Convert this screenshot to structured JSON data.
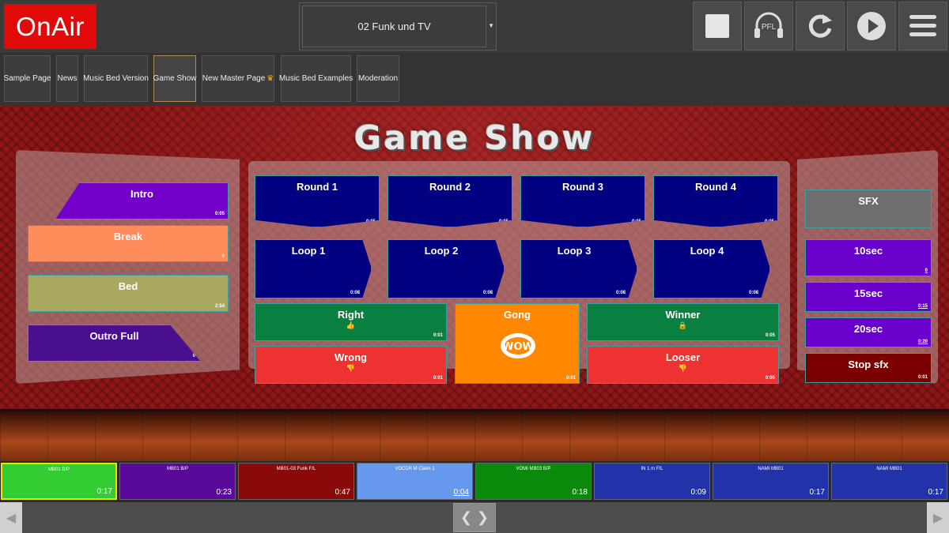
{
  "header": {
    "logo": "OnAir",
    "playlist": "02 Funk und TV",
    "buttons": {
      "stop": "stop-icon",
      "pfl": "PFL",
      "reload": "reload-icon",
      "play": "play-icon",
      "menu": "menu-icon"
    }
  },
  "tabs": [
    {
      "label": "Sample Page"
    },
    {
      "label": "News"
    },
    {
      "label": "Music Bed Version"
    },
    {
      "label": "Game Show",
      "active": true
    },
    {
      "label": "New Master Page"
    },
    {
      "label": "Music Bed Examples"
    },
    {
      "label": "Moderation"
    }
  ],
  "stage": {
    "title": "Game Show"
  },
  "left_carts": [
    {
      "label": "Intro",
      "time": "0:05",
      "color": "#7300c8"
    },
    {
      "label": "Break",
      "time": "0",
      "color": "#ff8c5a"
    },
    {
      "label": "Bed",
      "time": "2:54",
      "color": "#a8a860"
    },
    {
      "label": "Outro Full",
      "time": "0",
      "color": "#4a0f8f"
    }
  ],
  "rounds": [
    {
      "label": "Round 1",
      "time": "0:05"
    },
    {
      "label": "Round 2",
      "time": "0:05"
    },
    {
      "label": "Round 3",
      "time": "0:05"
    },
    {
      "label": "Round 4",
      "time": "0:05"
    }
  ],
  "loops": [
    {
      "label": "Loop 1",
      "time": "0:08"
    },
    {
      "label": "Loop 2",
      "time": "0:08"
    },
    {
      "label": "Loop 3",
      "time": "0:08"
    },
    {
      "label": "Loop 4",
      "time": "0:08"
    }
  ],
  "answers": {
    "right": {
      "label": "Right",
      "time": "0:01",
      "color": "#0a8040"
    },
    "gong": {
      "label": "Gong",
      "time": "0:01",
      "color": "#ff8800",
      "logo": "WOW"
    },
    "winner": {
      "label": "Winner",
      "time": "0:05",
      "color": "#0a8040"
    },
    "wrong": {
      "label": "Wrong",
      "time": "0:01",
      "color": "#ee3232"
    },
    "looser": {
      "label": "Looser",
      "time": "0:05",
      "color": "#ee3232"
    }
  },
  "sfx": [
    {
      "label": "SFX",
      "time": "",
      "color": "#6e6e6e"
    },
    {
      "label": "10sec",
      "time": "0",
      "color": "#6a00cc"
    },
    {
      "label": "15sec",
      "time": "0:15",
      "color": "#6a00cc"
    },
    {
      "label": "20sec",
      "time": "0:20",
      "color": "#6a00cc"
    },
    {
      "label": "Stop sfx",
      "time": "0:01",
      "color": "#7a0000"
    }
  ],
  "players": [
    {
      "name": "MB01 B/P",
      "time": "0:17",
      "color": "#33cc33",
      "selected": true
    },
    {
      "name": "MB01 B/P",
      "time": "0:23",
      "color": "#5a0a9a"
    },
    {
      "name": "MB01-03 Funk F/L",
      "time": "0:47",
      "color": "#8a0a0a"
    },
    {
      "name": "VOCDR M Claim 1",
      "time": "0:04",
      "color": "#6699ee"
    },
    {
      "name": "VOMI MB03 B/P",
      "time": "0:18",
      "color": "#0a8a0a"
    },
    {
      "name": "IN 1 m F/L",
      "time": "0:09",
      "color": "#2233aa"
    },
    {
      "name": "NAMI MB01",
      "time": "0:17",
      "color": "#2233aa"
    },
    {
      "name": "NAMI MB01",
      "time": "0:17",
      "color": "#2233aa"
    }
  ]
}
